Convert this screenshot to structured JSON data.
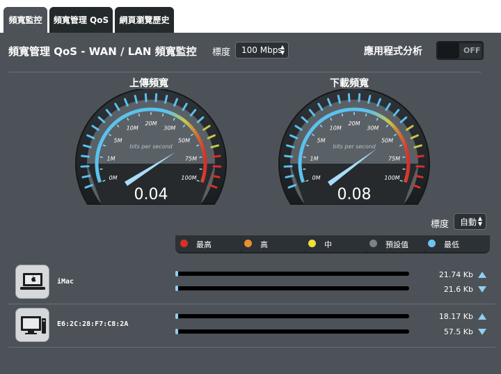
{
  "tabs": [
    {
      "label": "頻寬監控",
      "active": true
    },
    {
      "label": "頻寬管理 QoS",
      "active": false
    },
    {
      "label": "網頁瀏覽歷史",
      "active": false
    }
  ],
  "header": {
    "title": "頻寬管理 QoS - WAN / LAN 頻寬監控",
    "scale_label": "標度",
    "scale_value": "100 Mbps",
    "app_analysis_label": "應用程式分析",
    "app_analysis_toggle": "OFF"
  },
  "gauges": [
    {
      "title": "上傳頻寬",
      "value": "0.04",
      "units": "bits per second",
      "ticks": [
        "0M",
        "1M",
        "5M",
        "10M",
        "20M",
        "30M",
        "50M",
        "75M",
        "100M"
      ],
      "reading": 0.04
    },
    {
      "title": "下載頻寬",
      "value": "0.08",
      "units": "bits per second",
      "ticks": [
        "0M",
        "1M",
        "5M",
        "10M",
        "20M",
        "30M",
        "50M",
        "75M",
        "100M"
      ],
      "reading": 0.08
    }
  ],
  "client_scale": {
    "label": "標度",
    "value": "自動"
  },
  "priorities": [
    {
      "label": "最高",
      "color": "#d6302a"
    },
    {
      "label": "高",
      "color": "#e8902e"
    },
    {
      "label": "中",
      "color": "#f0de3a"
    },
    {
      "label": "預設值",
      "color": "#7c8184"
    },
    {
      "label": "最低",
      "color": "#6cc4ee"
    }
  ],
  "clients": [
    {
      "name": "iMac",
      "icon": "apple-laptop-icon",
      "upload": "21.74 Kb",
      "download": "21.6 Kb",
      "upload_fill": 0.01,
      "download_fill": 0.01
    },
    {
      "name": "E6:2C:28:F7:C8:2A",
      "icon": "monitor-icon",
      "upload": "18.17 Kb",
      "download": "57.5 Kb",
      "upload_fill": 0.01,
      "download_fill": 0.01
    }
  ],
  "colors": {
    "panel": "#4c5257",
    "accent": "#8fd0ef",
    "tab_inactive": "#24292c"
  }
}
